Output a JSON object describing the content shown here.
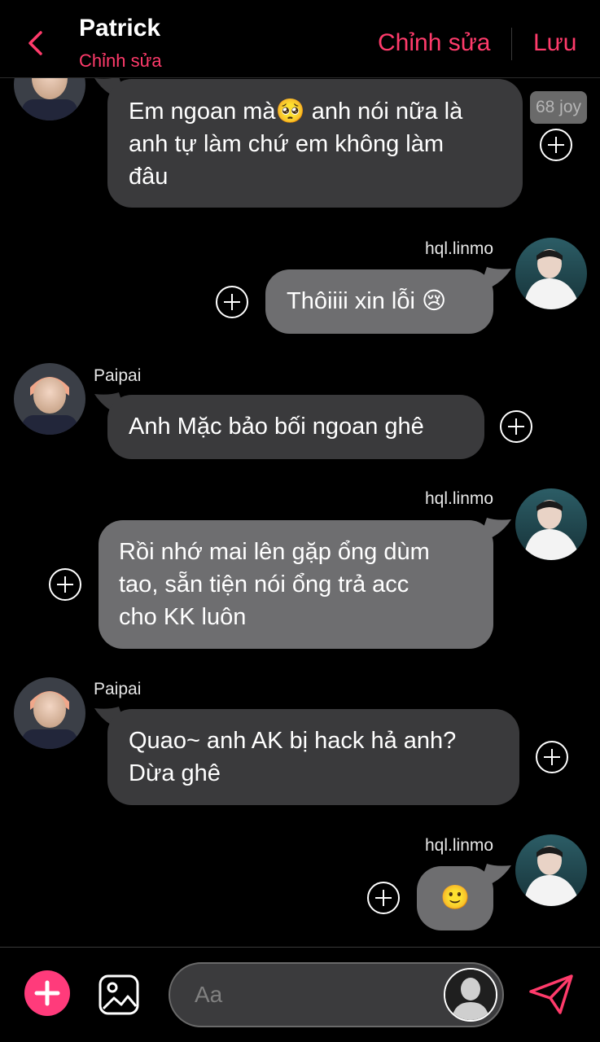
{
  "header": {
    "title": "Patrick",
    "subtitle": "Chỉnh sửa",
    "edit_label": "Chỉnh sửa",
    "save_label": "Lưu"
  },
  "badge": "68 joy",
  "messages": [
    {
      "side": "left",
      "sender": "",
      "text_lines": [
        "Em ngoan mà🥺 anh nói nữa là",
        "anh tự làm chứ em không làm",
        "đâu"
      ]
    },
    {
      "side": "right",
      "sender": "hql.linmo",
      "text_lines": [
        "Thôiiii xin lỗi 😢"
      ]
    },
    {
      "side": "left",
      "sender": "Paipai",
      "text_lines": [
        "Anh Mặc bảo bối ngoan ghê"
      ]
    },
    {
      "side": "right",
      "sender": "hql.linmo",
      "text_lines": [
        "Rồi nhớ mai lên gặp ổng dùm",
        "tao, sẵn tiện nói ổng trả acc",
        "cho KK luôn"
      ]
    },
    {
      "side": "left",
      "sender": "Paipai",
      "text_lines": [
        "Quao~ anh AK bị hack hả anh?",
        "Dừa ghê"
      ]
    },
    {
      "side": "right",
      "sender": "hql.linmo",
      "text_lines": [
        "🙂"
      ]
    }
  ],
  "composer": {
    "placeholder": "Aa"
  },
  "colors": {
    "accent": "#ff3b6b",
    "bubble_left": "#3a3a3c",
    "bubble_right": "#6e6e70",
    "background": "#000000"
  },
  "icons": {
    "back": "chevron-left-icon",
    "add": "plus-circle-icon",
    "image": "image-icon",
    "send": "paper-plane-icon",
    "add_message": "plus-outline-icon"
  }
}
